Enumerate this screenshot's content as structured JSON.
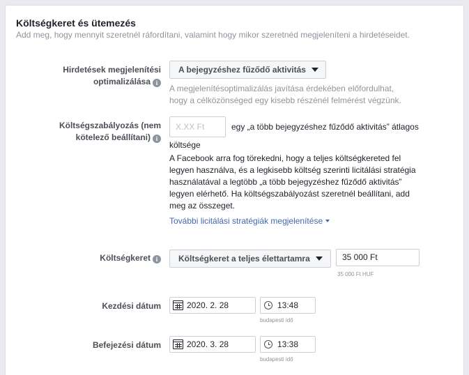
{
  "section": {
    "title": "Költségkeret és ütemezés",
    "subtitle": "Add meg, hogy mennyit szeretnél ráfordítani, valamint hogy mikor szeretnéd megjeleníteni a hirdetéseidet."
  },
  "optimization": {
    "label_line1": "Hirdetések megjelenítési",
    "label_line2": "optimalizálása",
    "dropdown_value": "A bejegyzéshez fűződő aktivitás",
    "help_line1": "A megjelenítésoptimalizálás javítása érdekében előfordulhat,",
    "help_line2": "hogy a célközönséged egy kisebb részénél felmérést végzünk."
  },
  "cost_control": {
    "label_line1": "Költségszabályozás (nem",
    "label_line2": "kötelező beállítani)",
    "input_placeholder": "X.XX Ft",
    "suffix_line1": "egy „a több bejegyzéshez fűződő aktivitás” átlagos",
    "suffix_line2": "költsége",
    "description_lines": [
      "A Facebook arra fog törekedni, hogy a teljes költségkereted fel",
      "legyen használva, és a legkisebb költség szerinti licitálási stratégia",
      "használatával a legtöbb „a több bejegyzéshez fűződő aktivitás”",
      "legyen elérhető. Ha költségszabályozást szeretnél beállítani, add",
      "meg az összeget."
    ],
    "more_link": "További licitálási stratégiák megjelenítése"
  },
  "budget": {
    "label": "Költségkeret",
    "type_dropdown": "Költségkeret a teljes élettartamra",
    "amount_value": "35 000 Ft",
    "amount_note": "35 000 Ft HUF"
  },
  "start": {
    "label": "Kezdési dátum",
    "date": "2020. 2. 28",
    "time": "13:48",
    "timezone": "budapesti idő"
  },
  "end": {
    "label": "Befejezési dátum",
    "date": "2020. 3. 28",
    "time": "13:38",
    "timezone": "budapesti idő"
  },
  "icons": {
    "info": "info-icon",
    "dropdown": "caret-down-icon",
    "calendar": "calendar-icon",
    "clock": "clock-icon"
  },
  "colors": {
    "link": "#4267b2",
    "muted": "#90949c",
    "label": "#4b4f56"
  }
}
